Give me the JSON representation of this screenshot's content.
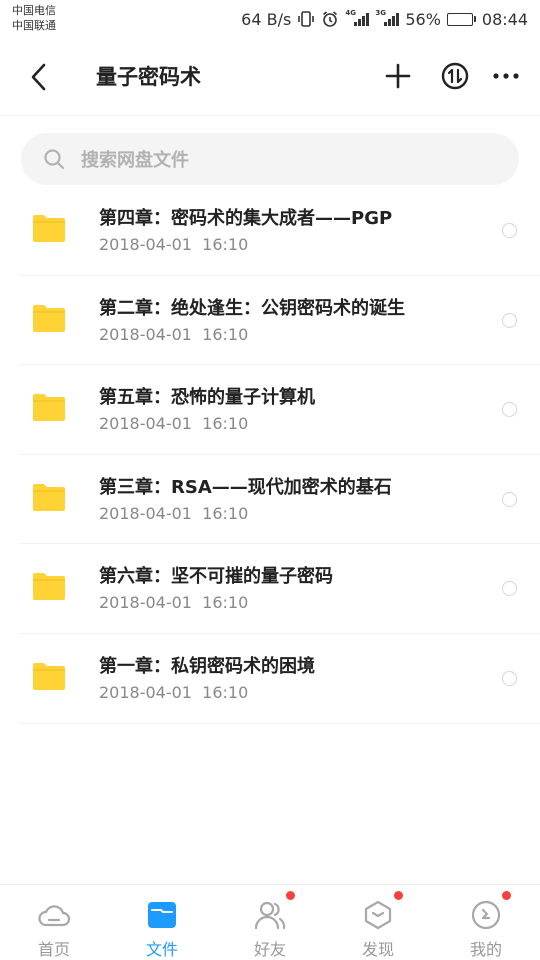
{
  "status_bar": {
    "carrier_1": "中国电信",
    "carrier_2": "中国联通",
    "net_speed": "64 B/s",
    "net_tag_1": "4G",
    "net_tag_2": "3G",
    "battery_percent": "56%",
    "battery_level": 0.56,
    "time": "08:44"
  },
  "header": {
    "title": "量子密码术",
    "back_icon": "chevron-left-icon",
    "add_icon": "plus-icon",
    "transfer_icon": "transfer-icon",
    "more_icon": "more-icon"
  },
  "search": {
    "placeholder": "搜索网盘文件"
  },
  "files": [
    {
      "name": "第四章：密码术的集大成者——PGP",
      "date": "2018-04-01  16:10"
    },
    {
      "name": "第二章：绝处逢生：公钥密码术的诞生",
      "date": "2018-04-01  16:10"
    },
    {
      "name": "第五章：恐怖的量子计算机",
      "date": "2018-04-01  16:10"
    },
    {
      "name": "第三章：RSA——现代加密术的基石",
      "date": "2018-04-01  16:10"
    },
    {
      "name": "第六章：坚不可摧的量子密码",
      "date": "2018-04-01  16:10"
    },
    {
      "name": "第一章：私钥密码术的困境",
      "date": "2018-04-01  16:10"
    }
  ],
  "tabs": [
    {
      "label": "首页",
      "icon": "cloud-icon",
      "active": false,
      "badge": false
    },
    {
      "label": "文件",
      "icon": "folder-icon",
      "active": true,
      "badge": false
    },
    {
      "label": "好友",
      "icon": "friends-icon",
      "active": false,
      "badge": true
    },
    {
      "label": "发现",
      "icon": "discover-icon",
      "active": false,
      "badge": true
    },
    {
      "label": "我的",
      "icon": "profile-icon",
      "active": false,
      "badge": true
    }
  ],
  "colors": {
    "accent": "#1d9bff",
    "folder": "#ffd236",
    "badge": "#f5413d",
    "inactive": "#999999"
  }
}
